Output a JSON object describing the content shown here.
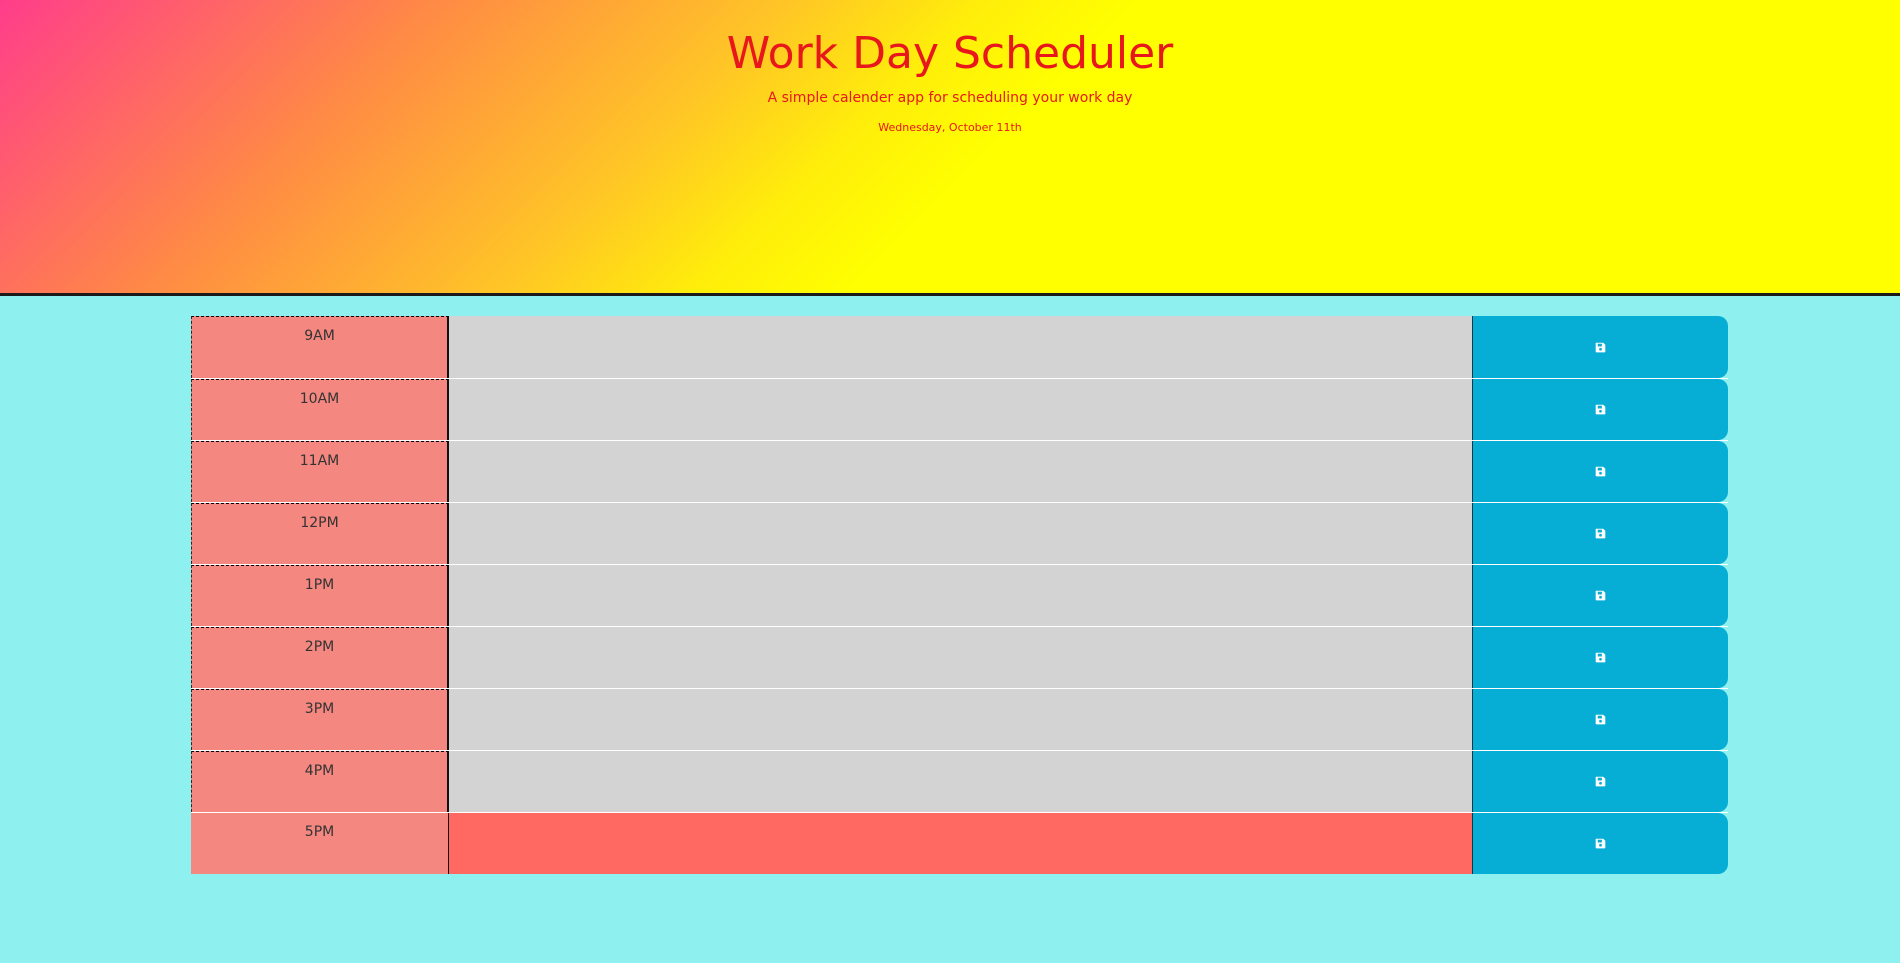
{
  "header": {
    "title": "Work Day Scheduler",
    "subtitle": "A simple calender app for scheduling your work day",
    "current_day": "Wednesday, October 11th"
  },
  "colors": {
    "past": "#d3d3d3",
    "present": "#ff6961",
    "hour_block": "#f4877f",
    "save_button": "#06aed5",
    "page_background": "#8ff0f0",
    "header_text": "#e8171b"
  },
  "timeblocks": [
    {
      "hour": "9AM",
      "text": "",
      "state": "past",
      "save_icon": "save-icon"
    },
    {
      "hour": "10AM",
      "text": "",
      "state": "past",
      "save_icon": "save-icon"
    },
    {
      "hour": "11AM",
      "text": "",
      "state": "past",
      "save_icon": "save-icon"
    },
    {
      "hour": "12PM",
      "text": "",
      "state": "past",
      "save_icon": "save-icon"
    },
    {
      "hour": "1PM",
      "text": "",
      "state": "past",
      "save_icon": "save-icon"
    },
    {
      "hour": "2PM",
      "text": "",
      "state": "past",
      "save_icon": "save-icon"
    },
    {
      "hour": "3PM",
      "text": "",
      "state": "past",
      "save_icon": "save-icon"
    },
    {
      "hour": "4PM",
      "text": "",
      "state": "past",
      "save_icon": "save-icon"
    },
    {
      "hour": "5PM",
      "text": "",
      "state": "present",
      "save_icon": "save-icon"
    }
  ]
}
